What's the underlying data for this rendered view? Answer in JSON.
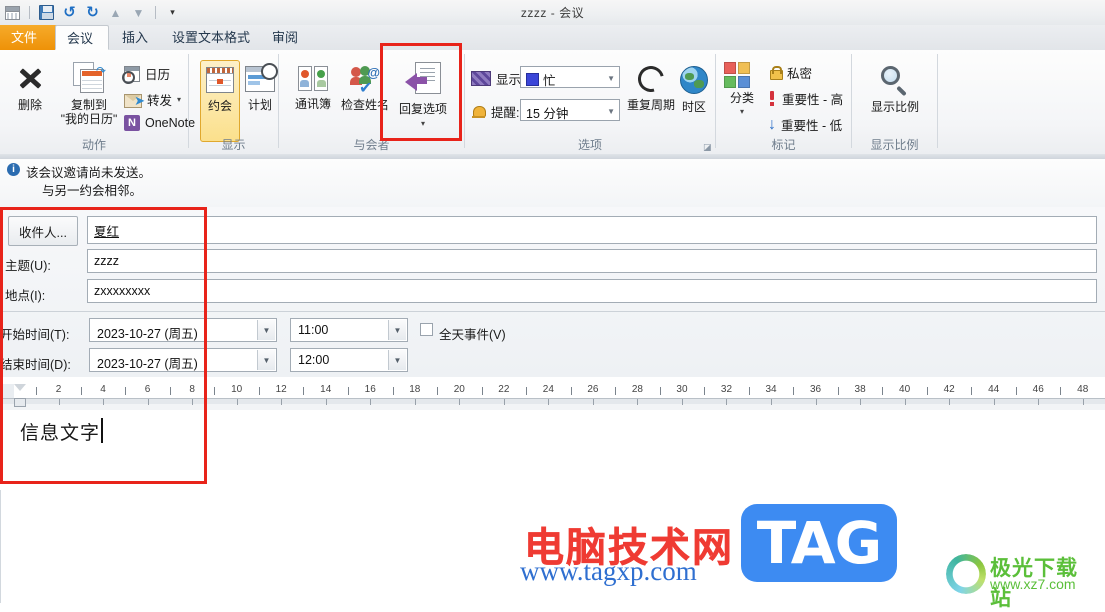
{
  "window": {
    "title": "zzzz - 会议",
    "quick_access": [
      {
        "name": "app-calendar-icon",
        "label": ""
      },
      {
        "name": "save-icon",
        "label": ""
      },
      {
        "name": "undo-icon",
        "label": "↺"
      },
      {
        "name": "redo-icon",
        "label": "↻"
      },
      {
        "name": "previous-item-icon",
        "label": "▲"
      },
      {
        "name": "next-item-icon",
        "label": "▼"
      },
      {
        "name": "customize-qat-icon",
        "label": "▾"
      }
    ]
  },
  "tabs": [
    {
      "label": "文件",
      "state": "file"
    },
    {
      "label": "会议",
      "state": "active"
    },
    {
      "label": "插入",
      "state": "normal"
    },
    {
      "label": "设置文本格式",
      "state": "normal"
    },
    {
      "label": "审阅",
      "state": "normal"
    }
  ],
  "ribbon": {
    "groups": [
      {
        "name": "动作",
        "label": "动作"
      },
      {
        "name": "显示",
        "label": "显示"
      },
      {
        "name": "与会者",
        "label": "与会者"
      },
      {
        "name": "选项",
        "label": "选项"
      },
      {
        "name": "标记",
        "label": "标记"
      },
      {
        "name": "显示比例",
        "label": "显示比例"
      }
    ],
    "actions": {
      "delete": "删除",
      "copy_to_line1": "复制到",
      "copy_to_line2": "\"我的日历\"",
      "calendar": "日历",
      "forward": "转发",
      "onenote": "OneNote"
    },
    "show": {
      "appointment": "约会",
      "scheduling": "计划"
    },
    "attendees": {
      "address_book": "通讯簿",
      "check_names": "检查姓名",
      "response_options": "回复选项"
    },
    "options": {
      "show_as_label": "显示为:",
      "show_as_value": "忙",
      "reminder_label": "提醒:",
      "reminder_value": "15 分钟",
      "recurrence": "重复周期",
      "time_zones": "时区"
    },
    "tags": {
      "categorize": "分类",
      "private": "私密",
      "high_importance": "重要性 - 高",
      "low_importance": "重要性 - 低"
    },
    "zoom": {
      "zoom_button": "显示比例"
    }
  },
  "infobar": {
    "line1": "该会议邀请尚未发送。",
    "line2": "与另一约会相邻。",
    "icon": "info-icon"
  },
  "form": {
    "to_button": "收件人...",
    "to_value": "夏红",
    "subject_label": "主题(U):",
    "subject_value": "zzzz",
    "location_label": "地点(I):",
    "location_value": "zxxxxxxxx",
    "start_label": "开始时间(T):",
    "start_date": "2023-10-27 (周五)",
    "start_time": "11:00",
    "end_label": "结束时间(D):",
    "end_date": "2023-10-27 (周五)",
    "end_time": "12:00",
    "all_day_label": "全天事件(V)",
    "all_day_checked": false
  },
  "ruler": {
    "numbers": [
      2,
      4,
      6,
      8,
      10,
      12,
      14,
      16,
      18,
      20,
      22,
      24,
      26,
      28,
      30,
      32,
      34,
      36,
      38,
      40,
      42,
      44,
      46,
      48
    ]
  },
  "body": {
    "text": "信息文字"
  },
  "watermarks": {
    "cn_title": "电脑技术网",
    "url": "www.tagxp.com",
    "tag": "TAG",
    "xz_title": "极光下载站",
    "xz_url": "www.xz7.com"
  },
  "colors": {
    "file_tab": "#ee9208",
    "annotation_red": "#e8231a",
    "busy_swatch": "#3b46d8",
    "watermark_red": "#ef3b33",
    "watermark_blue": "#3d8bf2",
    "xz_green": "#5bbf3a"
  }
}
